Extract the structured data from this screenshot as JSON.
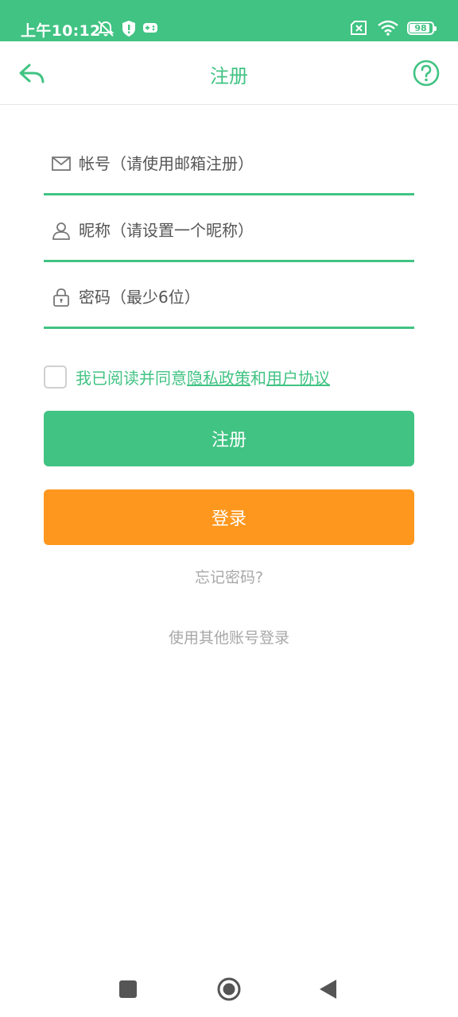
{
  "status_bar": {
    "time": "上午10:12",
    "battery": "98",
    "battery_level": 0.98,
    "background": "#41c383",
    "icons": [
      "bell-off-icon",
      "shield-alert-icon",
      "gamepad-icon",
      "sim-off-icon",
      "wifi-icon",
      "battery-icon"
    ]
  },
  "header": {
    "title": "注册",
    "back_icon": "reply-arrow-icon",
    "help_icon": "question-circle-icon"
  },
  "form": {
    "account_placeholder": "帐号（请使用邮箱注册）",
    "account_value": "",
    "nickname_placeholder": "昵称（请设置一个昵称）",
    "nickname_value": "",
    "password_placeholder": "密码（最少6位）",
    "password_value": "",
    "icons": [
      "mail-icon",
      "user-icon",
      "lock-icon"
    ]
  },
  "agreement": {
    "checked": false,
    "text_prefix": "我已阅读并同意",
    "privacy_link": "隐私政策",
    "conjunction": "和",
    "terms_link": "用户协议"
  },
  "buttons": {
    "register": "注册",
    "login": "登录"
  },
  "links": {
    "forgot": "忘记密码?",
    "other_login": "使用其他账号登录"
  },
  "colors": {
    "primary": "#41c383",
    "orange": "#fe971d",
    "muted": "#a8a8a8"
  },
  "nav_bar": {
    "icons": [
      "square-icon",
      "circle-home-icon",
      "triangle-back-icon"
    ]
  }
}
